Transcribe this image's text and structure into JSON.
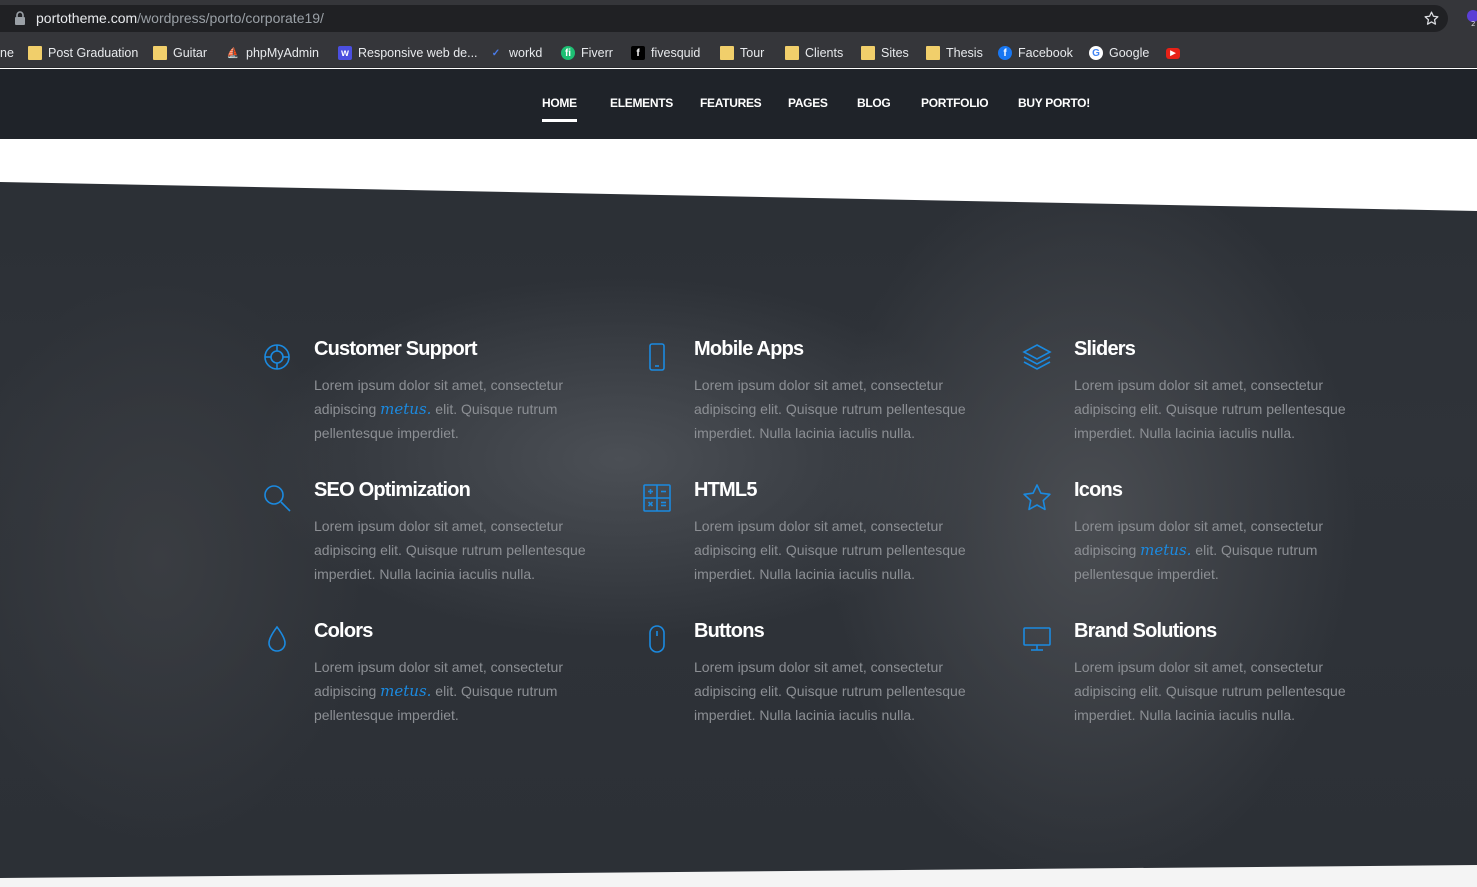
{
  "browser": {
    "url_host": "portotheme.com",
    "url_path": "/wordpress/porto/corporate19/",
    "bookmarks": [
      {
        "label": "Post Graduation",
        "icon": "folder-icon"
      },
      {
        "label": "Guitar",
        "icon": "folder-icon"
      },
      {
        "label": "phpMyAdmin",
        "icon": "phpmyadmin-icon"
      },
      {
        "label": "Responsive web de...",
        "icon": "w-icon"
      },
      {
        "label": "workd",
        "icon": "workd-icon"
      },
      {
        "label": "Fiverr",
        "icon": "fiverr-icon"
      },
      {
        "label": "fivesquid",
        "icon": "fivesquid-icon"
      },
      {
        "label": "Tour",
        "icon": "folder-icon"
      },
      {
        "label": "Clients",
        "icon": "folder-icon"
      },
      {
        "label": "Sites",
        "icon": "folder-icon"
      },
      {
        "label": "Thesis",
        "icon": "folder-icon"
      },
      {
        "label": "Facebook",
        "icon": "facebook-icon"
      },
      {
        "label": "Google",
        "icon": "google-icon"
      }
    ],
    "partial_left_label": "ne"
  },
  "nav": {
    "items": [
      "HOME",
      "ELEMENTS",
      "FEATURES",
      "PAGES",
      "BLOG",
      "PORTFOLIO",
      "BUY PORTO!"
    ],
    "active": "HOME"
  },
  "features": [
    {
      "title": "Customer Support",
      "icon": "lifebuoy-icon",
      "text_a": "Lorem ipsum dolor sit amet, consectetur adipiscing ",
      "script": "metus.",
      "text_b": " elit. Quisque rutrum pellentesque imperdiet."
    },
    {
      "title": "Mobile Apps",
      "icon": "mobile-icon",
      "text_a": "Lorem ipsum dolor sit amet, consectetur adipiscing elit. Quisque rutrum pellentesque imperdiet. Nulla lacinia iaculis nulla.",
      "script": "",
      "text_b": ""
    },
    {
      "title": "Sliders",
      "icon": "layers-icon",
      "text_a": "Lorem ipsum dolor sit amet, consectetur adipiscing elit. Quisque rutrum pellentesque imperdiet. Nulla lacinia iaculis nulla.",
      "script": "",
      "text_b": ""
    },
    {
      "title": "SEO Optimization",
      "icon": "search-icon",
      "text_a": "Lorem ipsum dolor sit amet, consectetur adipiscing elit. Quisque rutrum pellentesque imperdiet. Nulla lacinia iaculis nulla.",
      "script": "",
      "text_b": ""
    },
    {
      "title": "HTML5",
      "icon": "calculator-icon",
      "text_a": "Lorem ipsum dolor sit amet, consectetur adipiscing elit. Quisque rutrum pellentesque imperdiet. Nulla lacinia iaculis nulla.",
      "script": "",
      "text_b": ""
    },
    {
      "title": "Icons",
      "icon": "star-outline-icon",
      "text_a": "Lorem ipsum dolor sit amet, consectetur adipiscing ",
      "script": "metus.",
      "text_b": " elit. Quisque rutrum pellentesque imperdiet."
    },
    {
      "title": "Colors",
      "icon": "drop-icon",
      "text_a": "Lorem ipsum dolor sit amet, consectetur adipiscing ",
      "script": "metus.",
      "text_b": " elit. Quisque rutrum pellentesque imperdiet."
    },
    {
      "title": "Buttons",
      "icon": "mouse-icon",
      "text_a": "Lorem ipsum dolor sit amet, consectetur adipiscing elit. Quisque rutrum pellentesque imperdiet. Nulla lacinia iaculis nulla.",
      "script": "",
      "text_b": ""
    },
    {
      "title": "Brand Solutions",
      "icon": "monitor-icon",
      "text_a": "Lorem ipsum dolor sit amet, consectetur adipiscing elit. Quisque rutrum pellentesque imperdiet. Nulla lacinia iaculis nulla.",
      "script": "",
      "text_b": ""
    }
  ],
  "colors": {
    "accent": "#1b8ae0",
    "header_bg": "#1f2329",
    "body_text": "#8c8f94"
  }
}
